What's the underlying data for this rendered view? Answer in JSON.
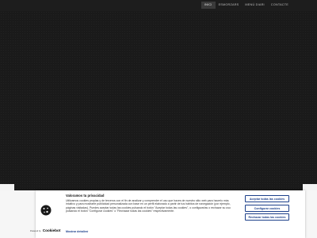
{
  "nav": {
    "items": [
      {
        "label": "INICI",
        "active": true
      },
      {
        "label": "ESMORZARS",
        "active": false
      },
      {
        "label": "MENÚ DIARI",
        "active": false
      },
      {
        "label": "CONTACTE",
        "active": false
      }
    ]
  },
  "cookie_banner": {
    "title": "Valoramos tu privacidad",
    "body": "Utilizamos cookies propias y de terceros con el fin de analizar y comprender el uso que haces de nuestro sitio web para hacerlo más intuitivo y para mostrarte publicidad personalizada con base en un perfil elaborado a partir de tus hábitos de navegación (por ejemplo, páginas visitadas). Puedes aceptar todas las cookies pulsando el botón \"Aceptar todas las cookies\", o configurarlas o rechazar su uso pulsando el botón \"Configurar cookies\" o \"Rechazar todas las cookies\" respectivamente.",
    "accept_label": "Aceptar todas las cookies",
    "config_label": "Configurar cookies",
    "reject_label": "Rechazar todas las cookies",
    "more_label": "Mostrar detalles",
    "powered_label": "Powered by",
    "logo_text": "Cookiebot",
    "colors": {
      "accent": "#1c3f8a",
      "background": "#1b1b1b"
    },
    "icons": {
      "cookie": "cookie-icon",
      "chevron": "chevron-right-icon"
    }
  }
}
